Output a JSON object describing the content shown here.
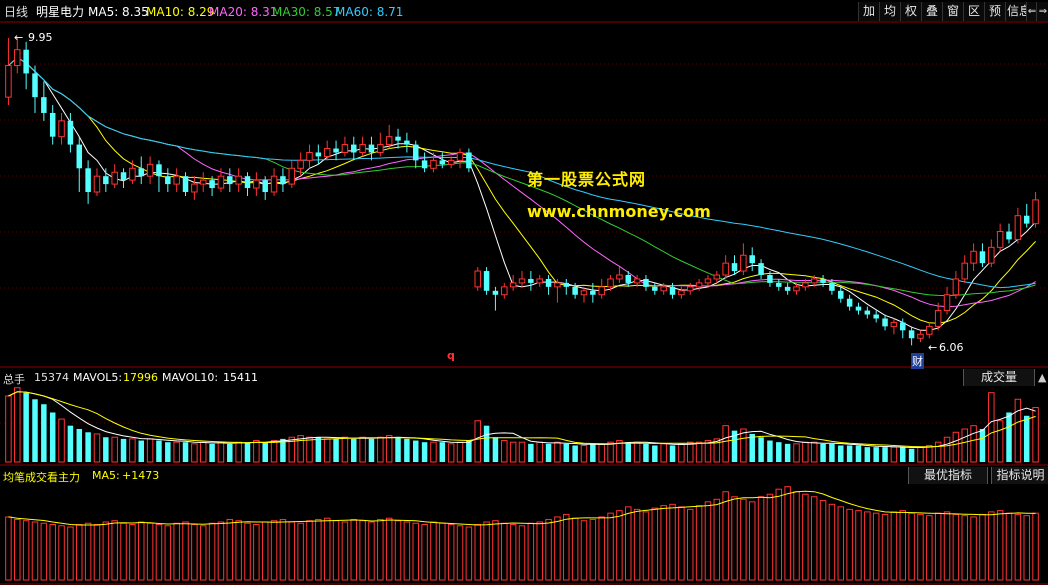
{
  "header": {
    "period": "日线",
    "stock_name": "明星电力",
    "ma": [
      {
        "label": "MA5: 8.35",
        "color": "#ffffff"
      },
      {
        "label": "MA10: 8.29",
        "color": "#ffff00"
      },
      {
        "label": "MA20: 8.31",
        "color": "#ff66ff"
      },
      {
        "label": "MA30: 8.57",
        "color": "#33cc33"
      },
      {
        "label": "MA60: 8.71",
        "color": "#33ccff"
      }
    ],
    "toolbar": [
      "加",
      "均",
      "权",
      "叠",
      "窗",
      "区",
      "预",
      "信息",
      "⇐",
      "⇒"
    ]
  },
  "price_panel": {
    "high_label": "9.95",
    "low_label": "6.06",
    "marker_q": "q",
    "marker_cai": "财"
  },
  "watermark": {
    "line1": "第一股票公式网",
    "line2": "www.chnmoney.com"
  },
  "volume_panel": {
    "title": "总手",
    "value": "15374",
    "mavol5_label": "MAVOL5:",
    "mavol5_value": "17996",
    "mavol10_label": "MAVOL10:",
    "mavol10_value": "15411",
    "selector": "成交量"
  },
  "indicator_panel": {
    "title": "均笔成交看主力",
    "ma5_label": "MA5:",
    "ma5_value": "+1473",
    "best_button": "最优指标",
    "help_button": "指标说明"
  },
  "colors": {
    "up": "#ff3333",
    "down": "#54ffff",
    "ma5": "#ffffff",
    "ma10": "#ffff00",
    "ma20": "#ff66ff",
    "ma30": "#33cc33",
    "ma60": "#33ccff",
    "grid": "#8b0000",
    "watermark": "#ffee00"
  },
  "chart_data": {
    "type": "candlestick",
    "price_range": [
      5.9,
      10.1
    ],
    "candles": [
      [
        9.2,
        9.6,
        9.95,
        9.1
      ],
      [
        9.6,
        9.8,
        9.95,
        9.5
      ],
      [
        9.8,
        9.5,
        9.9,
        9.3
      ],
      [
        9.5,
        9.2,
        9.6,
        9.0
      ],
      [
        9.2,
        9.0,
        9.4,
        8.9
      ],
      [
        9.0,
        8.7,
        9.1,
        8.6
      ],
      [
        8.7,
        8.9,
        9.0,
        8.6
      ],
      [
        8.9,
        8.6,
        9.0,
        8.5
      ],
      [
        8.6,
        8.3,
        8.7,
        8.0
      ],
      [
        8.3,
        8.0,
        8.4,
        7.85
      ],
      [
        8.0,
        8.2,
        8.3,
        7.95
      ],
      [
        8.2,
        8.1,
        8.3,
        8.0
      ],
      [
        8.1,
        8.25,
        8.35,
        8.05
      ],
      [
        8.25,
        8.15,
        8.3,
        8.05
      ],
      [
        8.15,
        8.3,
        8.4,
        8.1
      ],
      [
        8.3,
        8.2,
        8.45,
        8.1
      ],
      [
        8.2,
        8.35,
        8.45,
        8.1
      ],
      [
        8.35,
        8.2,
        8.4,
        8.0
      ],
      [
        8.2,
        8.1,
        8.3,
        8.0
      ],
      [
        8.1,
        8.2,
        8.3,
        8.0
      ],
      [
        8.2,
        8.0,
        8.25,
        7.95
      ],
      [
        8.0,
        8.1,
        8.2,
        7.9
      ],
      [
        8.1,
        8.15,
        8.25,
        8.0
      ],
      [
        8.15,
        8.05,
        8.2,
        7.95
      ],
      [
        8.05,
        8.2,
        8.3,
        8.0
      ],
      [
        8.2,
        8.1,
        8.3,
        8.0
      ],
      [
        8.1,
        8.2,
        8.3,
        8.0
      ],
      [
        8.2,
        8.05,
        8.25,
        7.95
      ],
      [
        8.05,
        8.15,
        8.25,
        7.95
      ],
      [
        8.15,
        8.0,
        8.2,
        7.9
      ],
      [
        8.0,
        8.2,
        8.3,
        7.95
      ],
      [
        8.2,
        8.1,
        8.3,
        8.0
      ],
      [
        8.1,
        8.3,
        8.4,
        8.05
      ],
      [
        8.3,
        8.4,
        8.5,
        8.2
      ],
      [
        8.4,
        8.5,
        8.6,
        8.3
      ],
      [
        8.5,
        8.45,
        8.6,
        8.35
      ],
      [
        8.45,
        8.55,
        8.65,
        8.4
      ],
      [
        8.55,
        8.5,
        8.65,
        8.4
      ],
      [
        8.5,
        8.6,
        8.7,
        8.45
      ],
      [
        8.6,
        8.5,
        8.7,
        8.4
      ],
      [
        8.5,
        8.6,
        8.7,
        8.45
      ],
      [
        8.6,
        8.5,
        8.7,
        8.4
      ],
      [
        8.5,
        8.6,
        8.75,
        8.45
      ],
      [
        8.6,
        8.7,
        8.85,
        8.55
      ],
      [
        8.7,
        8.65,
        8.8,
        8.55
      ],
      [
        8.65,
        8.6,
        8.75,
        8.5
      ],
      [
        8.6,
        8.4,
        8.65,
        8.3
      ],
      [
        8.4,
        8.3,
        8.5,
        8.25
      ],
      [
        8.3,
        8.4,
        8.5,
        8.25
      ],
      [
        8.4,
        8.35,
        8.5,
        8.3
      ],
      [
        8.35,
        8.4,
        8.45,
        8.3
      ],
      [
        8.4,
        8.5,
        8.55,
        8.3
      ],
      [
        8.5,
        8.3,
        8.55,
        8.25
      ],
      [
        6.8,
        7.0,
        7.05,
        6.75
      ],
      [
        7.0,
        6.75,
        7.05,
        6.7
      ],
      [
        6.75,
        6.7,
        6.8,
        6.5
      ],
      [
        6.7,
        6.8,
        6.85,
        6.65
      ],
      [
        6.8,
        6.85,
        6.95,
        6.75
      ],
      [
        6.85,
        6.9,
        7.0,
        6.8
      ],
      [
        6.9,
        6.85,
        7.0,
        6.75
      ],
      [
        6.85,
        6.9,
        6.95,
        6.8
      ],
      [
        6.9,
        6.8,
        6.95,
        6.7
      ],
      [
        6.8,
        6.85,
        6.9,
        6.6
      ],
      [
        6.85,
        6.8,
        6.9,
        6.7
      ],
      [
        6.8,
        6.7,
        6.85,
        6.65
      ],
      [
        6.7,
        6.75,
        6.8,
        6.6
      ],
      [
        6.75,
        6.7,
        6.85,
        6.6
      ],
      [
        6.7,
        6.8,
        6.9,
        6.65
      ],
      [
        6.8,
        6.9,
        6.95,
        6.75
      ],
      [
        6.9,
        6.95,
        7.05,
        6.85
      ],
      [
        6.95,
        6.85,
        7.0,
        6.8
      ],
      [
        6.85,
        6.9,
        6.95,
        6.8
      ],
      [
        6.9,
        6.8,
        6.95,
        6.75
      ],
      [
        6.8,
        6.75,
        6.85,
        6.7
      ],
      [
        6.75,
        6.8,
        6.85,
        6.7
      ],
      [
        6.8,
        6.7,
        6.85,
        6.65
      ],
      [
        6.7,
        6.75,
        6.8,
        6.65
      ],
      [
        6.75,
        6.8,
        6.85,
        6.7
      ],
      [
        6.8,
        6.85,
        6.9,
        6.75
      ],
      [
        6.85,
        6.9,
        6.95,
        6.8
      ],
      [
        6.9,
        6.95,
        7.0,
        6.85
      ],
      [
        6.95,
        7.1,
        7.2,
        6.9
      ],
      [
        7.1,
        7.0,
        7.2,
        6.95
      ],
      [
        7.0,
        7.2,
        7.35,
        6.95
      ],
      [
        7.2,
        7.1,
        7.3,
        7.0
      ],
      [
        7.1,
        6.95,
        7.15,
        6.9
      ],
      [
        6.95,
        6.85,
        7.0,
        6.8
      ],
      [
        6.85,
        6.8,
        6.9,
        6.75
      ],
      [
        6.8,
        6.75,
        6.85,
        6.7
      ],
      [
        6.75,
        6.8,
        6.85,
        6.7
      ],
      [
        6.8,
        6.85,
        6.9,
        6.75
      ],
      [
        6.85,
        6.9,
        6.95,
        6.8
      ],
      [
        6.9,
        6.85,
        6.95,
        6.8
      ],
      [
        6.85,
        6.75,
        6.9,
        6.7
      ],
      [
        6.75,
        6.65,
        6.8,
        6.6
      ],
      [
        6.65,
        6.55,
        6.7,
        6.5
      ],
      [
        6.55,
        6.5,
        6.6,
        6.45
      ],
      [
        6.5,
        6.45,
        6.55,
        6.4
      ],
      [
        6.45,
        6.4,
        6.5,
        6.35
      ],
      [
        6.4,
        6.3,
        6.45,
        6.25
      ],
      [
        6.3,
        6.35,
        6.4,
        6.2
      ],
      [
        6.35,
        6.25,
        6.4,
        6.15
      ],
      [
        6.25,
        6.15,
        6.3,
        6.06
      ],
      [
        6.15,
        6.2,
        6.25,
        6.1
      ],
      [
        6.2,
        6.3,
        6.35,
        6.15
      ],
      [
        6.3,
        6.5,
        6.6,
        6.25
      ],
      [
        6.5,
        6.7,
        6.8,
        6.45
      ],
      [
        6.7,
        6.9,
        7.0,
        6.65
      ],
      [
        6.9,
        7.1,
        7.2,
        6.85
      ],
      [
        7.1,
        7.25,
        7.35,
        7.0
      ],
      [
        7.25,
        7.1,
        7.35,
        7.05
      ],
      [
        7.1,
        7.3,
        7.4,
        7.05
      ],
      [
        7.3,
        7.5,
        7.6,
        7.25
      ],
      [
        7.5,
        7.4,
        7.6,
        7.35
      ],
      [
        7.4,
        7.7,
        7.8,
        7.35
      ],
      [
        7.7,
        7.6,
        7.85,
        7.55
      ],
      [
        7.6,
        7.9,
        8.0,
        7.55
      ]
    ],
    "volume": [
      40,
      45,
      42,
      38,
      35,
      30,
      26,
      22,
      20,
      18,
      17,
      15,
      15,
      14,
      14,
      13,
      14,
      13,
      12,
      12,
      12,
      11,
      12,
      11,
      12,
      11,
      12,
      12,
      13,
      12,
      13,
      14,
      15,
      16,
      15,
      15,
      14,
      14,
      15,
      14,
      15,
      14,
      15,
      16,
      15,
      14,
      13,
      12,
      12,
      12,
      11,
      12,
      13,
      25,
      22,
      15,
      13,
      12,
      12,
      11,
      12,
      11,
      12,
      11,
      10,
      10,
      11,
      11,
      12,
      13,
      12,
      12,
      11,
      10,
      11,
      10,
      11,
      12,
      12,
      13,
      14,
      22,
      19,
      20,
      17,
      15,
      13,
      12,
      11,
      11,
      12,
      12,
      11,
      11,
      10,
      10,
      10,
      9,
      9,
      9,
      9,
      9,
      8,
      9,
      10,
      12,
      15,
      18,
      20,
      22,
      20,
      42,
      25,
      30,
      38,
      28,
      33
    ],
    "indicator": [
      50,
      48,
      47,
      46,
      45,
      44,
      43,
      42,
      44,
      45,
      44,
      46,
      47,
      45,
      44,
      46,
      45,
      44,
      43,
      45,
      46,
      44,
      43,
      45,
      46,
      48,
      47,
      45,
      44,
      46,
      47,
      48,
      46,
      45,
      47,
      48,
      49,
      47,
      46,
      48,
      47,
      46,
      48,
      49,
      47,
      46,
      45,
      44,
      46,
      45,
      44,
      43,
      42,
      44,
      46,
      47,
      45,
      44,
      43,
      45,
      46,
      48,
      50,
      52,
      49,
      47,
      48,
      50,
      53,
      55,
      58,
      56,
      54,
      57,
      59,
      60,
      58,
      56,
      59,
      62,
      64,
      70,
      66,
      64,
      62,
      66,
      68,
      72,
      74,
      70,
      68,
      66,
      63,
      60,
      58,
      56,
      55,
      54,
      53,
      52,
      54,
      55,
      53,
      52,
      51,
      53,
      54,
      52,
      51,
      50,
      52,
      54,
      55,
      53,
      52,
      51,
      53
    ]
  }
}
